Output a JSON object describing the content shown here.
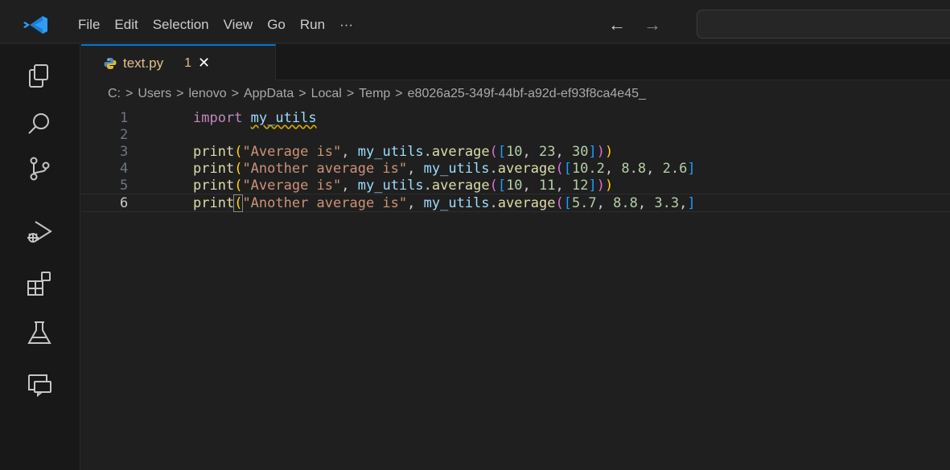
{
  "menu": {
    "items": [
      "File",
      "Edit",
      "Selection",
      "View",
      "Go",
      "Run",
      "···"
    ]
  },
  "nav": {
    "back_icon": "←",
    "forward_icon": "→"
  },
  "activity_bar": {
    "icons": [
      "explorer-icon",
      "search-icon",
      "source-control-icon",
      "run-debug-icon",
      "extensions-icon",
      "testing-icon",
      "remote-explorer-icon"
    ]
  },
  "tab": {
    "filename": "text.py",
    "problems_count": "1",
    "close_glyph": "✕",
    "language_icon": "python-icon"
  },
  "breadcrumb": [
    "C:",
    "Users",
    "lenovo",
    "AppData",
    "Local",
    "Temp",
    "e8026a25-349f-44bf-a92d-ef93f8ca4e45_"
  ],
  "breadcrumb_separator": ">",
  "editor": {
    "active_line": 6,
    "lines": [
      {
        "number": "1",
        "text": "import my_utils"
      },
      {
        "number": "2",
        "text": ""
      },
      {
        "number": "3",
        "text": "print(\"Average is\", my_utils.average([10, 23, 30]))"
      },
      {
        "number": "4",
        "text": "print(\"Another average is\", my_utils.average([10.2, 8.8, 2.6]"
      },
      {
        "number": "5",
        "text": "print(\"Average is\", my_utils.average([10, 11, 12]))"
      },
      {
        "number": "6",
        "text": "print(\"Another average is\", my_utils.average([5.7, 8.8, 3.3,]"
      }
    ]
  },
  "colors": {
    "accent": "#0078d4",
    "background": "#1f1f1f",
    "tab_modified": "#e2c08d"
  }
}
